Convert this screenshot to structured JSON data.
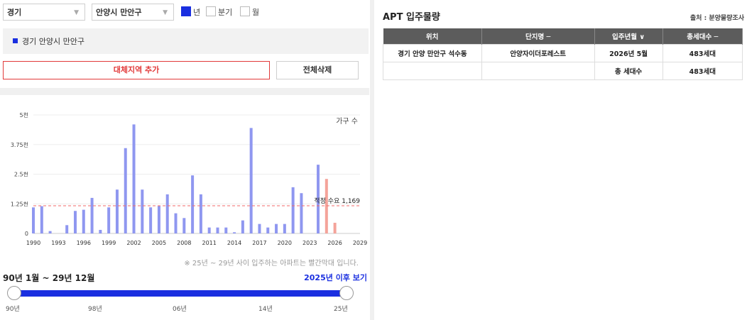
{
  "filters": {
    "province": "경기",
    "district": "안양시 만안구",
    "checkboxes": [
      {
        "label": "년",
        "checked": true
      },
      {
        "label": "분기",
        "checked": false
      },
      {
        "label": "월",
        "checked": false
      }
    ]
  },
  "region_label": "경기 안양시 만안구",
  "buttons": {
    "add_region": "대체지역 추가",
    "delete_all": "전체삭제"
  },
  "chart_data": {
    "type": "bar",
    "legend": "가구 수",
    "ylim": [
      0,
      5000
    ],
    "y_ticks": [
      "0",
      "1.25천",
      "2.5천",
      "3.75천",
      "5천"
    ],
    "x_ticks": [
      "1990",
      "1993",
      "1996",
      "1999",
      "2002",
      "2005",
      "2008",
      "2011",
      "2014",
      "2017",
      "2020",
      "2023",
      "2026",
      "2029"
    ],
    "x": [
      1990,
      1991,
      1992,
      1993,
      1994,
      1995,
      1996,
      1997,
      1998,
      1999,
      2000,
      2001,
      2002,
      2003,
      2004,
      2005,
      2006,
      2007,
      2008,
      2009,
      2010,
      2011,
      2012,
      2013,
      2014,
      2015,
      2016,
      2017,
      2018,
      2019,
      2020,
      2021,
      2022,
      2023,
      2024,
      2025,
      2026,
      2027,
      2028,
      2029
    ],
    "values": [
      1100,
      1150,
      100,
      0,
      350,
      950,
      1000,
      1500,
      150,
      1100,
      1850,
      3600,
      4600,
      1850,
      1100,
      1150,
      1650,
      850,
      650,
      2450,
      1650,
      250,
      250,
      250,
      50,
      550,
      4450,
      400,
      250,
      400,
      400,
      1950,
      1700,
      0,
      2900,
      2300,
      450,
      0,
      0,
      0
    ],
    "highlight_years": [
      2025,
      2026,
      2027,
      2028,
      2029
    ],
    "colors": {
      "normal": "#8f97f0",
      "highlight": "#f4a39a",
      "threshold": "#f26a6a"
    },
    "threshold": {
      "value": 1169,
      "label": "적정 수요 1,169"
    }
  },
  "note": "※ 25년 ~ 29년 사이 입주하는 아파트는 빨간막대 입니다.",
  "period": {
    "label": "90년 1월 ~ 29년 12월",
    "after_link": "2025년 이후 보기",
    "range_start": "90년",
    "range_end": "25년",
    "ticks": [
      "90년",
      "98년",
      "06년",
      "14년",
      "25년"
    ]
  },
  "apt": {
    "title": "APT 입주물량",
    "source": "출처 : 분양물량조사",
    "columns": [
      "위치",
      "단지명 ─",
      "입주년월 ∨",
      "총세대수 ─"
    ],
    "rows": [
      [
        "경기 안양 만안구 석수동",
        "안양자이더포레스트",
        "2026년 5월",
        "483세대"
      ],
      [
        "",
        "",
        "총 세대수",
        "483세대"
      ]
    ]
  }
}
